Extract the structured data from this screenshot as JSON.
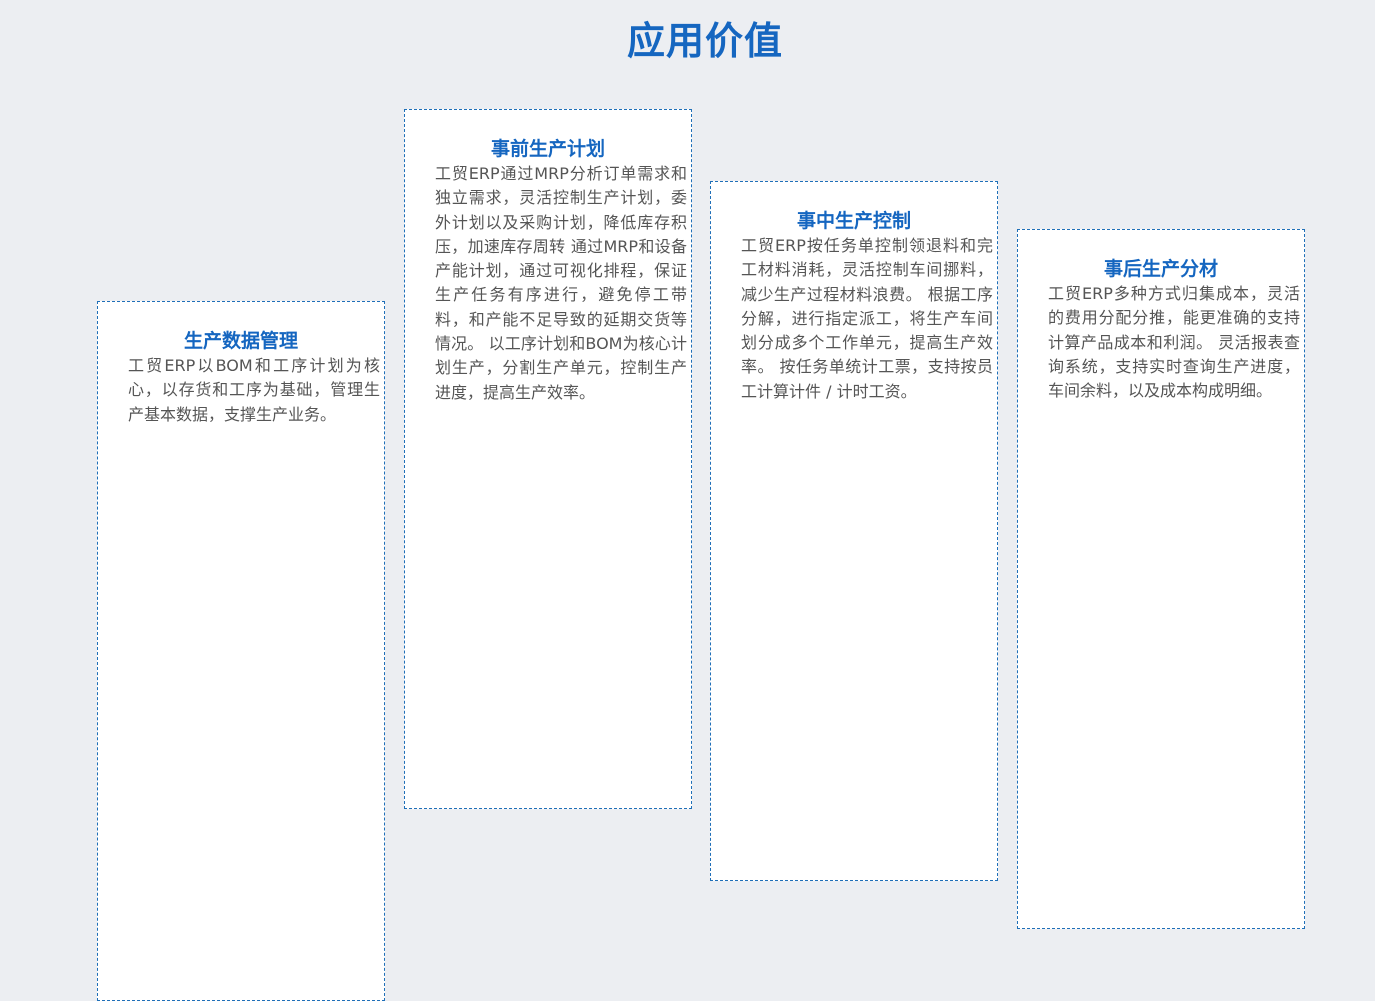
{
  "page": {
    "title": "应用价值"
  },
  "cards": [
    {
      "title": "生产数据管理",
      "body": "工贸ERP以BOM和工序计划为核心，以存货和工序为基础，管理生产基本数据，支撑生产业务。"
    },
    {
      "title": "事前生产计划",
      "body": "工贸ERP通过MRP分析订单需求和独立需求，灵活控制生产计划，委外计划以及采购计划，降低库存积压，加速库存周转 通过MRP和设备产能计划，通过可视化排程，保证生产任务有序进行，避免停工带料，和产能不足导致的延期交货等情况。 以工序计划和BOM为核心计划生产，分割生产单元，控制生产进度，提高生产效率。"
    },
    {
      "title": "事中生产控制",
      "body": "工贸ERP按任务单控制领退料和完工材料消耗，灵活控制车间挪料，减少生产过程材料浪费。 根据工序分解，进行指定派工，将生产车间划分成多个工作单元，提高生产效率。 按任务单统计工票，支持按员工计算计件 / 计时工资。"
    },
    {
      "title": "事后生产分材",
      "body": "工贸ERP多种方式归集成本，灵活的费用分配分推，能更准确的支持计算产品成本和利润。 灵活报表查询系统，支持实时查询生产进度，车间余料，以及成本构成明细。"
    }
  ],
  "colors": {
    "background": "#eceef2",
    "accent": "#1566c0",
    "card_border": "#1f6fb8",
    "body_text": "#555555"
  }
}
